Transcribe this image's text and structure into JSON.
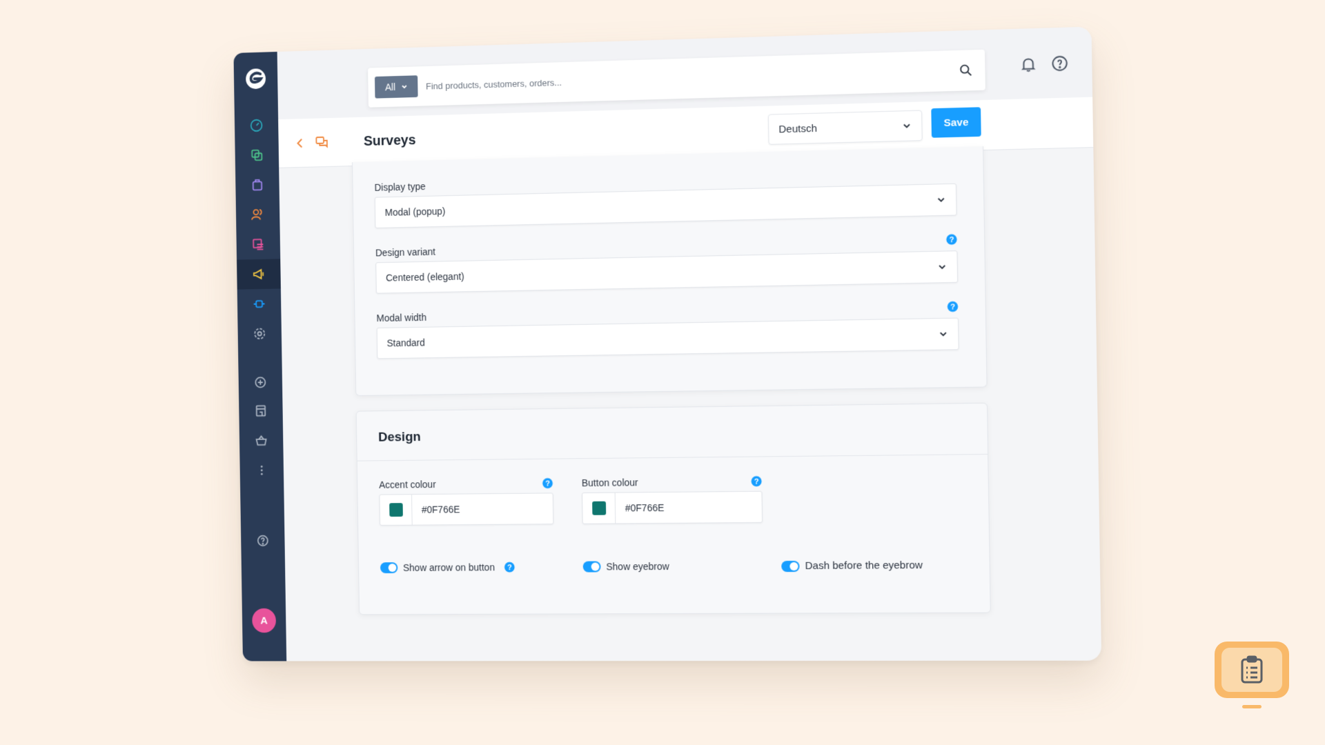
{
  "app": {
    "avatar_initial": "A"
  },
  "search": {
    "scope_label": "All",
    "placeholder": "Find products, customers, orders..."
  },
  "header": {
    "title": "Surveys",
    "language": "Deutsch",
    "save_label": "Save"
  },
  "sidebar": {
    "items": [
      {
        "name": "dashboard-icon",
        "color": "#2aa6b9"
      },
      {
        "name": "catalogues-icon",
        "color": "#4cc28a"
      },
      {
        "name": "orders-icon",
        "color": "#a086ef"
      },
      {
        "name": "customers-icon",
        "color": "#f0883e"
      },
      {
        "name": "content-icon",
        "color": "#e8539b"
      },
      {
        "name": "marketing-icon",
        "color": "#f5c842",
        "active": true
      },
      {
        "name": "extensions-icon",
        "color": "#189eff"
      },
      {
        "name": "settings-icon",
        "color": "#a9b3c1"
      },
      {
        "name": "add-icon",
        "color": "#a9b3c1"
      },
      {
        "name": "store-icon",
        "color": "#a9b3c1"
      },
      {
        "name": "basket-icon",
        "color": "#a9b3c1"
      },
      {
        "name": "more-icon",
        "color": "#a9b3c1"
      },
      {
        "name": "help-icon",
        "color": "#a9b3c1"
      }
    ]
  },
  "general": {
    "display_type": {
      "label": "Display type",
      "value": "Modal (popup)"
    },
    "design_variant": {
      "label": "Design variant",
      "value": "Centered (elegant)"
    },
    "modal_width": {
      "label": "Modal width",
      "value": "Standard"
    }
  },
  "design": {
    "title": "Design",
    "accent_colour": {
      "label": "Accent colour",
      "value": "#0F766E",
      "swatch": "#0f766e"
    },
    "button_colour": {
      "label": "Button colour",
      "value": "#0F766E",
      "swatch": "#0f766e"
    },
    "toggles": [
      {
        "label": "Show arrow on button",
        "on": true
      },
      {
        "label": "Show eyebrow",
        "on": true
      },
      {
        "label": "Dash before the eyebrow",
        "on": true
      }
    ]
  },
  "colors": {
    "accent": "#189eff",
    "sidebar": "#2a3b56",
    "badge": "#f9b969"
  }
}
